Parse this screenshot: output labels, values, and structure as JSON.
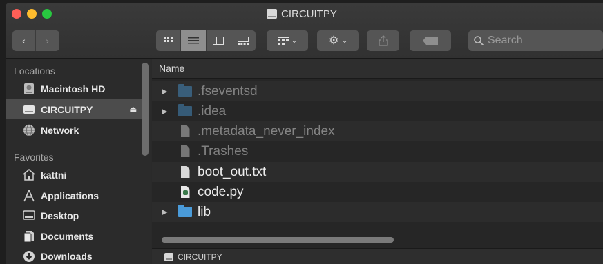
{
  "window": {
    "title": "CIRCUITPY"
  },
  "toolbar": {
    "back": "‹",
    "forward": "›",
    "views": [
      "icon-view",
      "list-view",
      "column-view",
      "gallery-view"
    ],
    "group_icon": "group-icon",
    "action_icon": "gear-icon",
    "share_icon": "share-icon",
    "tag_icon": "tag-icon",
    "search_placeholder": "Search"
  },
  "sidebar": {
    "locations_title": "Locations",
    "locations": [
      {
        "label": "Macintosh HD",
        "icon": "hard-drive-icon"
      },
      {
        "label": "CIRCUITPY",
        "icon": "external-drive-icon",
        "selected": true,
        "eject": "⏏"
      },
      {
        "label": "Network",
        "icon": "network-globe-icon"
      }
    ],
    "favorites_title": "Favorites",
    "favorites": [
      {
        "label": "kattni",
        "icon": "home-icon"
      },
      {
        "label": "Applications",
        "icon": "applications-icon"
      },
      {
        "label": "Desktop",
        "icon": "desktop-icon"
      },
      {
        "label": "Documents",
        "icon": "documents-icon"
      },
      {
        "label": "Downloads",
        "icon": "downloads-icon"
      }
    ]
  },
  "list": {
    "column_name": "Name",
    "rows": [
      {
        "name": ".fseventsd",
        "type": "folder",
        "hidden": true
      },
      {
        "name": ".idea",
        "type": "folder",
        "hidden": true
      },
      {
        "name": ".metadata_never_index",
        "type": "file",
        "hidden": true
      },
      {
        "name": ".Trashes",
        "type": "file",
        "hidden": true
      },
      {
        "name": "boot_out.txt",
        "type": "file",
        "hidden": false
      },
      {
        "name": "code.py",
        "type": "python",
        "hidden": false
      },
      {
        "name": "lib",
        "type": "folder",
        "hidden": false
      }
    ]
  },
  "pathbar": {
    "label": "CIRCUITPY"
  }
}
